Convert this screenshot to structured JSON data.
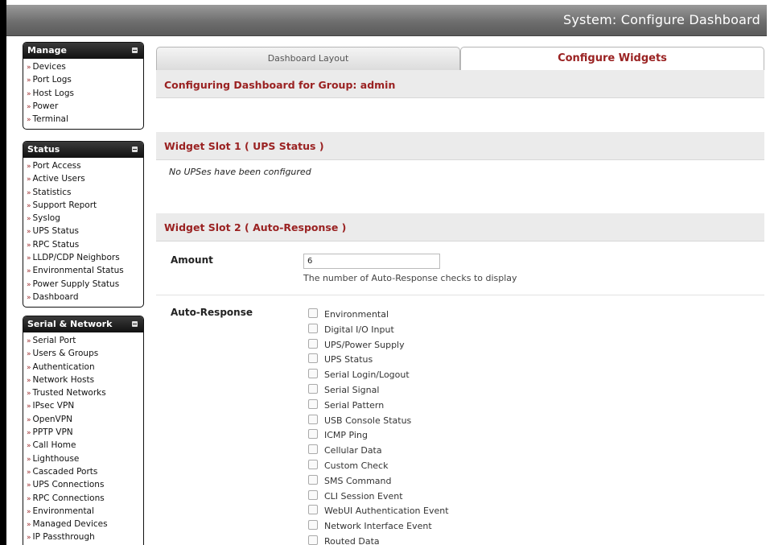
{
  "page_title": "System: Configure Dashboard",
  "sidebar": {
    "manage": {
      "title": "Manage",
      "items": [
        "Devices",
        "Port Logs",
        "Host Logs",
        "Power",
        "Terminal"
      ]
    },
    "status": {
      "title": "Status",
      "items": [
        "Port Access",
        "Active Users",
        "Statistics",
        "Support Report",
        "Syslog",
        "UPS Status",
        "RPC Status",
        "LLDP/CDP Neighbors",
        "Environmental Status",
        "Power Supply Status",
        "Dashboard"
      ]
    },
    "serial_network": {
      "title": "Serial & Network",
      "items": [
        "Serial Port",
        "Users & Groups",
        "Authentication",
        "Network Hosts",
        "Trusted Networks",
        "IPsec VPN",
        "OpenVPN",
        "PPTP VPN",
        "Call Home",
        "Lighthouse",
        "Cascaded Ports",
        "UPS Connections",
        "RPC Connections",
        "Environmental",
        "Managed Devices",
        "IP Passthrough"
      ]
    },
    "bullet": "»"
  },
  "tabs": {
    "layout": "Dashboard Layout",
    "widgets": "Configure Widgets"
  },
  "main": {
    "group_heading": "Configuring Dashboard for Group: admin",
    "slot1_heading": "Widget Slot 1 ( UPS Status )",
    "slot1_message": "No UPSes have been configured",
    "slot2_heading": "Widget Slot 2 ( Auto-Response )",
    "amount_label": "Amount",
    "amount_value": "6",
    "amount_help": "The number of Auto-Response checks to display",
    "auto_response_label": "Auto-Response",
    "auto_response_options": [
      "Environmental",
      "Digital I/O Input",
      "UPS/Power Supply",
      "UPS Status",
      "Serial Login/Logout",
      "Serial Signal",
      "Serial Pattern",
      "USB Console Status",
      "ICMP Ping",
      "Cellular Data",
      "Custom Check",
      "SMS Command",
      "CLI Session Event",
      "WebUI Authentication Event",
      "Network Interface Event",
      "Routed Data"
    ]
  },
  "colors": {
    "accent_red": "#9a2222",
    "sidebar_header": "#111111",
    "topbar": "#6e6e6e"
  }
}
